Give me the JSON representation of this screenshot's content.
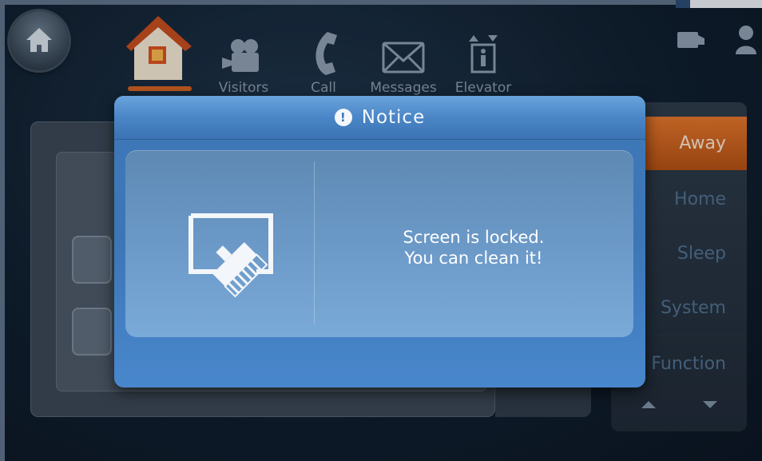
{
  "nav": {
    "items": [
      {
        "label": "Visitors",
        "icon": "video-camera-icon"
      },
      {
        "label": "Call",
        "icon": "phone-icon"
      },
      {
        "label": "Messages",
        "icon": "envelope-icon"
      },
      {
        "label": "Elevator",
        "icon": "elevator-icon"
      }
    ],
    "home_icon": "home-icon",
    "house_icon": "house-security-icon"
  },
  "top_right": {
    "icons": [
      "message-icon",
      "user-icon"
    ]
  },
  "modes": {
    "items": [
      "Away",
      "Home",
      "Sleep",
      "System",
      "Function"
    ],
    "active": "Away"
  },
  "dialog": {
    "title": "Notice",
    "title_icon": "exclamation-icon",
    "message_line1": "Screen is locked.",
    "message_line2": "You can clean it!",
    "body_icon": "screen-cleaning-icon"
  },
  "colors": {
    "dialog_blue": "#3c76b7",
    "active_orange": "#d5661f",
    "inactive_text": "#4e6e8c"
  }
}
